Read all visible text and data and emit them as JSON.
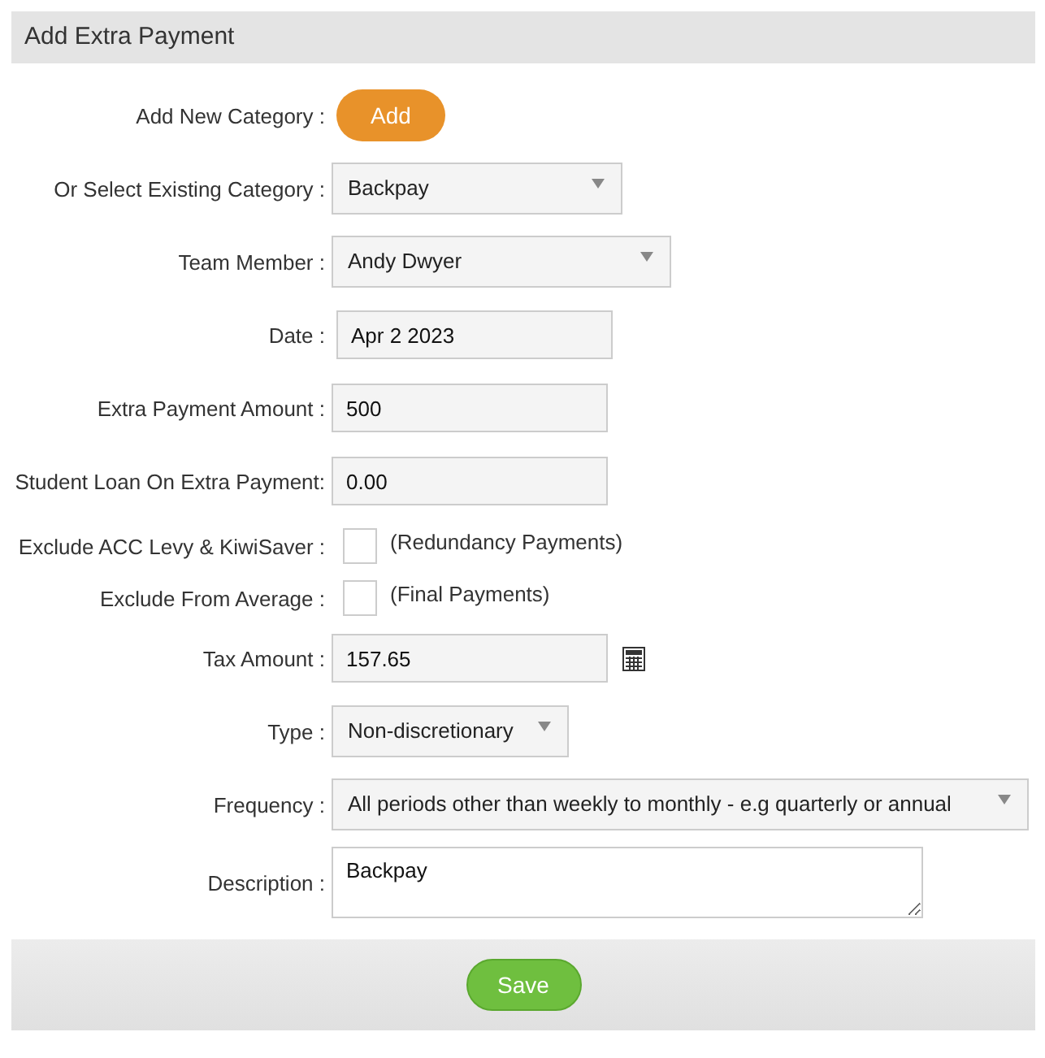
{
  "title": "Add Extra Payment",
  "fields": [
    {
      "kind": "button",
      "label": "Add New Category :",
      "text": "Add"
    },
    {
      "kind": "select",
      "label": "Or Select Existing Category :",
      "value": "Backpay"
    },
    {
      "kind": "select",
      "label": "Team Member :",
      "value": "Andy Dwyer"
    },
    {
      "kind": "text",
      "label": "Date :",
      "value": "Apr 2 2023"
    },
    {
      "kind": "text",
      "label": "Extra Payment Amount :",
      "value": "500"
    },
    {
      "kind": "text",
      "label": "Student Loan On Extra Payment:",
      "value": "0.00"
    },
    {
      "kind": "checkbox",
      "label": "Exclude ACC Levy & KiwiSaver :",
      "checked": false,
      "note": "(Redundancy Payments)"
    },
    {
      "kind": "checkbox",
      "label": "Exclude From Average :",
      "checked": false,
      "note": "(Final Payments)"
    },
    {
      "kind": "calc",
      "label": "Tax Amount :",
      "value": "157.65"
    },
    {
      "kind": "select",
      "label": "Type :",
      "value": "Non-discretionary"
    },
    {
      "kind": "select",
      "label": "Frequency :",
      "value": "All periods other than weekly to monthly - e.g quarterly or annual"
    },
    {
      "kind": "textarea",
      "label": "Description :",
      "value": "Backpay"
    }
  ],
  "footer": {
    "save": "Save"
  }
}
